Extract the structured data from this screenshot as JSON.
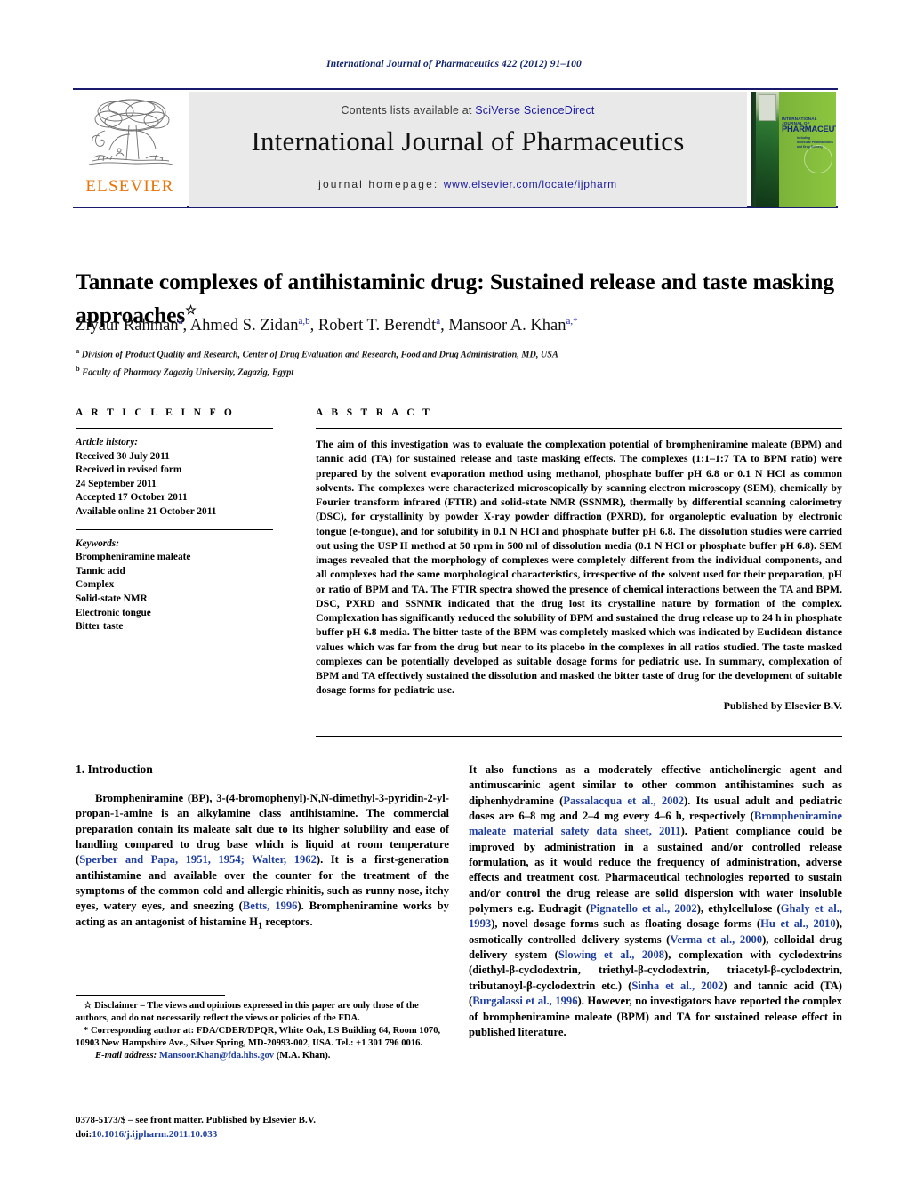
{
  "running_head": "International Journal of Pharmaceutics 422 (2012) 91–100",
  "masthead": {
    "contents_prefix": "Contents lists available at ",
    "contents_link": "SciVerse ScienceDirect",
    "journal_title": "International Journal of Pharmaceutics",
    "homepage_prefix": "journal homepage:",
    "homepage_link": "www.elsevier.com/locate/ijpharm",
    "publisher_wordmark": "ELSEVIER",
    "cover": {
      "line1": "INTERNATIONAL JOURNAL OF",
      "line2": "PHARMACEUTICS",
      "line3": "Including<br>Molecular Pharmaceutics<br>and Drug Delivery"
    },
    "colors": {
      "elsevier_orange": "#e8740c",
      "rule_navy": "#1a1a6e",
      "band_grey": "#e9e9e9",
      "link_blue": "#1c1ca0",
      "cover_green": "#8cc63f"
    }
  },
  "article": {
    "title": "Tannate complexes of antihistaminic drug: Sustained release and taste masking approaches",
    "title_footnote_marker": "☆",
    "authors": "Ziyaur Rahman|a|, Ahmed S. Zidan|a,b|, Robert T. Berendt|a|, Mansoor A. Khan|a,*|",
    "affiliations": [
      {
        "marker": "a",
        "text": "Division of Product Quality and Research, Center of Drug Evaluation and Research, Food and Drug Administration, MD, USA"
      },
      {
        "marker": "b",
        "text": "Faculty of Pharmacy Zagazig University, Zagazig, Egypt"
      }
    ]
  },
  "article_info": {
    "heading": "A R T I C L E   I N F O",
    "history_label": "Article history:",
    "history": [
      "Received 30 July 2011",
      "Received in revised form",
      "24 September 2011",
      "Accepted 17 October 2011",
      "Available online 21 October 2011"
    ],
    "keywords_label": "Keywords:",
    "keywords": [
      "Brompheniramine maleate",
      "Tannic acid",
      "Complex",
      "Solid-state NMR",
      "Electronic tongue",
      "Bitter taste"
    ]
  },
  "abstract": {
    "heading": "A B S T R A C T",
    "body": "The aim of this investigation was to evaluate the complexation potential of brompheniramine maleate (BPM) and tannic acid (TA) for sustained release and taste masking effects. The complexes (1:1–1:7 TA to BPM ratio) were prepared by the solvent evaporation method using methanol, phosphate buffer pH 6.8 or 0.1 N HCl as common solvents. The complexes were characterized microscopically by scanning electron microscopy (SEM), chemically by Fourier transform infrared (FTIR) and solid-state NMR (SSNMR), thermally by differential scanning calorimetry (DSC), for crystallinity by powder X-ray powder diffraction (PXRD), for organoleptic evaluation by electronic tongue (e-tongue), and for solubility in 0.1 N HCl and phosphate buffer pH 6.8. The dissolution studies were carried out using the USP II method at 50 rpm in 500 ml of dissolution media (0.1 N HCl or phosphate buffer pH 6.8). SEM images revealed that the morphology of complexes were completely different from the individual components, and all complexes had the same morphological characteristics, irrespective of the solvent used for their preparation, pH or ratio of BPM and TA. The FTIR spectra showed the presence of chemical interactions between the TA and BPM. DSC, PXRD and SSNMR indicated that the drug lost its crystalline nature by formation of the complex. Complexation has significantly reduced the solubility of BPM and sustained the drug release up to 24 h in phosphate buffer pH 6.8 media. The bitter taste of the BPM was completely masked which was indicated by Euclidean distance values which was far from the drug but near to its placebo in the complexes in all ratios studied. The taste masked complexes can be potentially developed as suitable dosage forms for pediatric use. In summary, complexation of BPM and TA effectively sustained the dissolution and masked the bitter taste of drug for the development of suitable dosage forms for pediatric use.",
    "published_by": "Published by Elsevier B.V."
  },
  "introduction": {
    "heading": "1.  Introduction",
    "left_paragraph_html": "Brompheniramine (BP), 3-(4-bromophenyl)-N,N-dimethyl-3-pyridin-2-yl-propan-1-amine is an alkylamine class antihistamine. The commercial preparation contain its maleate salt due to its higher solubility and ease of handling compared to drug base which is liquid at room temperature (<span class=\"ref\">Sperber and Papa, 1951, 1954; Walter, 1962</span>). It is a first-generation antihistamine and available over the counter for the treatment of the symptoms of the common cold and allergic rhinitis, such as runny nose, itchy eyes, watery eyes, and sneezing (<span class=\"ref\">Betts, 1996</span>). Brompheniramine works by acting as an antagonist of histamine H<sub>1</sub> receptors.",
    "right_paragraph_html": "It also functions as a moderately effective anticholinergic agent and antimuscarinic agent similar to other common antihistamines such as diphenhydramine (<span class=\"ref\">Passalacqua et al., 2002</span>). Its usual adult and pediatric doses are 6–8 mg and 2–4 mg every 4–6 h, respectively (<span class=\"ref\">Brompheniramine maleate material safety data sheet, 2011</span>). Patient compliance could be improved by administration in a sustained and/or controlled release formulation, as it would reduce the frequency of administration, adverse effects and treatment cost. Pharmaceutical technologies reported to sustain and/or control the drug release are solid dispersion with water insoluble polymers e.g. Eudragit (<span class=\"ref\">Pignatello et al., 2002</span>), ethylcellulose (<span class=\"ref\">Ghaly et al., 1993</span>), novel dosage forms such as floating dosage forms (<span class=\"ref\">Hu et al., 2010</span>), osmotically controlled delivery systems (<span class=\"ref\">Verma et al., 2000</span>), colloidal drug delivery system (<span class=\"ref\">Slowing et al., 2008</span>), complexation with cyclodextrins (diethyl-β-cyclodextrin, triethyl-β-cyclodextrin, triacetyl-β-cyclodextrin, tributanoyl-β-cyclodextrin etc.) (<span class=\"ref\">Sinha et al., 2002</span>) and tannic acid (TA) (<span class=\"ref\">Burgalassi et al., 1996</span>). However, no investigators have reported the complex of brompheniramine maleate (BPM) and TA for sustained release effect in published literature."
  },
  "footnotes": {
    "disclaimer_marker": "☆",
    "disclaimer_label": "Disclaimer",
    "disclaimer_text": "– The views and opinions expressed in this paper are only those of the authors, and do not necessarily reflect the views or policies of the FDA.",
    "corresponding_marker": "*",
    "corresponding_text": "Corresponding author at: FDA/CDER/DPQR, White Oak, LS Building 64, Room 1070, 10903 New Hampshire Ave., Silver Spring, MD-20993-002, USA. Tel.: +1 301 796 0016.",
    "email_label": "E-mail address:",
    "email": "Mansoor.Khan@fda.hhs.gov",
    "email_suffix": "(M.A. Khan)."
  },
  "imprint": {
    "issn_line": "0378-5173/$ – see front matter. Published by Elsevier B.V.",
    "doi_label": "doi:",
    "doi": "10.1016/j.ijpharm.2011.10.033"
  }
}
